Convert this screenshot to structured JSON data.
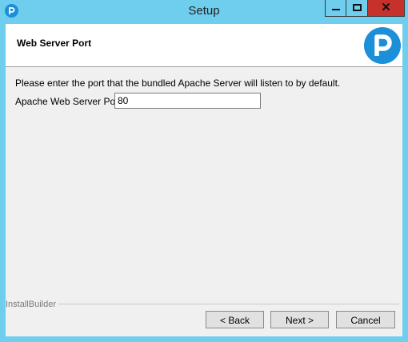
{
  "window": {
    "title": "Setup",
    "icon": "app-logo-icon",
    "controls": {
      "minimize": "minimize-icon",
      "maximize": "maximize-icon",
      "close": "✕"
    }
  },
  "header": {
    "title": "Web Server Port",
    "logo": "brand-p-logo"
  },
  "content": {
    "description": "Please enter the port that the bundled Apache Server will listen to by default.",
    "port_label": "Apache Web Server Port",
    "port_value": "80"
  },
  "footer": {
    "brand": "InstallBuilder",
    "back_label": "< Back",
    "next_label": "Next >",
    "cancel_label": "Cancel"
  },
  "colors": {
    "title_bar": "#6fcdee",
    "close_button": "#c7312b",
    "logo_blue": "#1c8fd9"
  }
}
